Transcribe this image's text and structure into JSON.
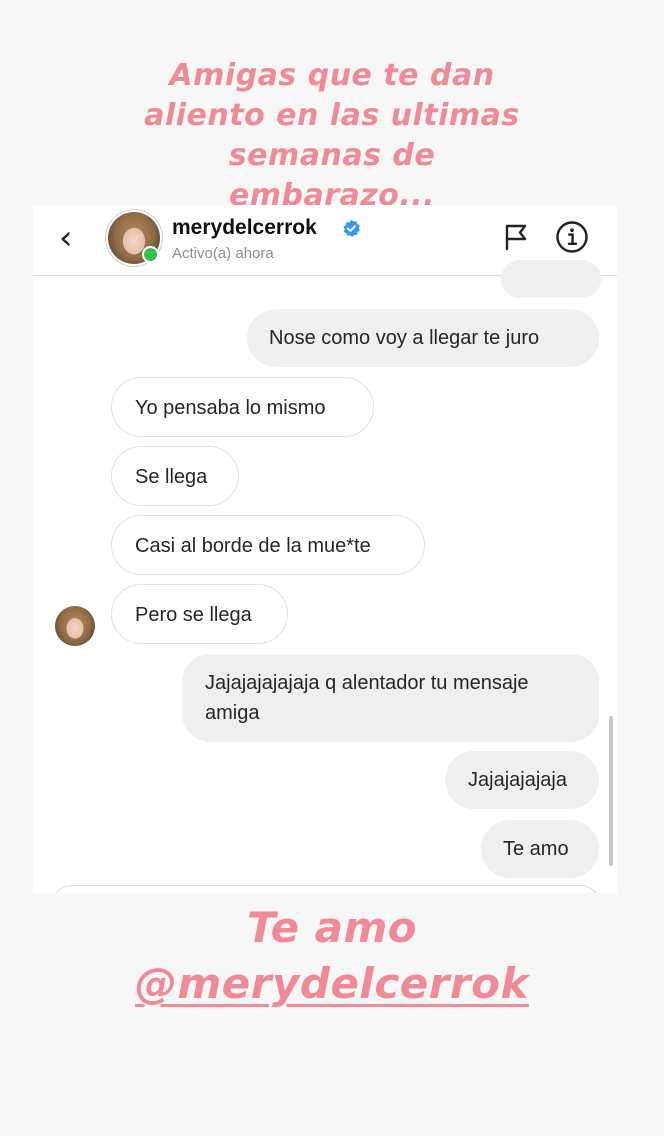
{
  "story": {
    "caption_top": [
      "Amigas que te dan",
      "aliento en las ultimas",
      "semanas de",
      "embarazo..."
    ],
    "caption_bottom": {
      "line1": "Te amo",
      "line2": "@merydelcerrok"
    },
    "caption_color": "#ef8a96"
  },
  "header": {
    "username": "merydelcerrok",
    "status": "Activo(a) ahora",
    "verified": true,
    "online": true,
    "icons": [
      "back-icon",
      "verified-icon",
      "flag-icon",
      "info-icon"
    ]
  },
  "messages": [
    {
      "sender": "me",
      "text": "Nose como voy a llegar te juro"
    },
    {
      "sender": "them",
      "text": "Yo pensaba lo mismo"
    },
    {
      "sender": "them",
      "text": "Se llega"
    },
    {
      "sender": "them",
      "text": "Casi al borde de la mue*te"
    },
    {
      "sender": "them",
      "text": "Pero se llega"
    },
    {
      "sender": "me",
      "text": "Jajajajajajaja q alentador tu mensaje",
      "text2": "amiga"
    },
    {
      "sender": "me",
      "text": "Jajajajajaja"
    },
    {
      "sender": "me",
      "text": "Te amo"
    }
  ]
}
